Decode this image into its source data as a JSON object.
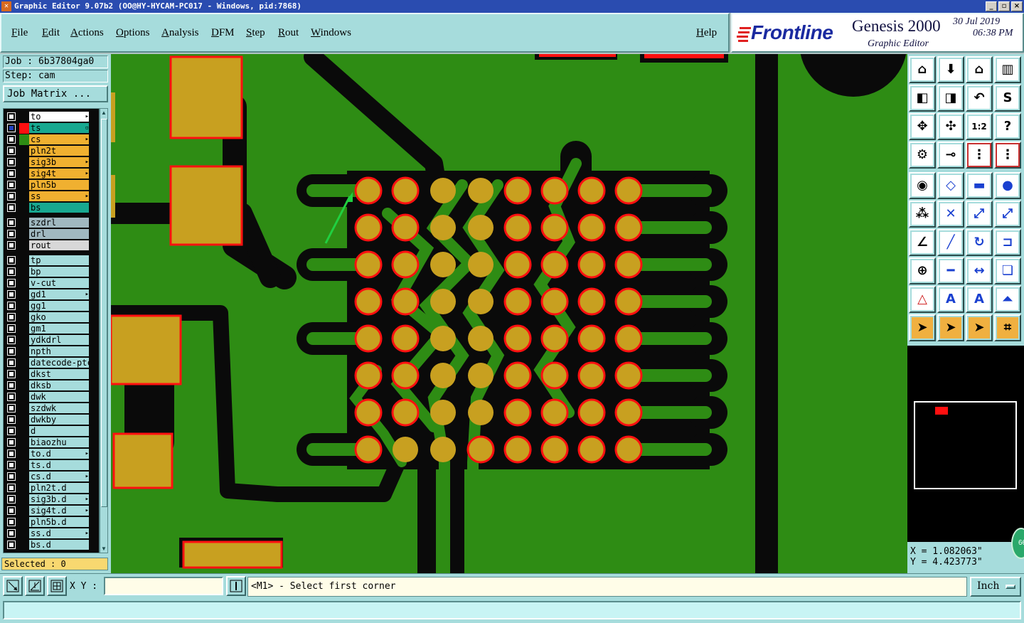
{
  "window": {
    "title": "Graphic Editor 9.07b2 (OO@HY-HYCAM-PC017 - Windows, pid:7868)",
    "app_icon": "x-app-icon",
    "controls": [
      "_",
      "▫",
      "×"
    ]
  },
  "menu": {
    "items": [
      "File",
      "Edit",
      "Actions",
      "Options",
      "Analysis",
      "DFM",
      "Step",
      "Rout",
      "Windows"
    ],
    "help": "Help"
  },
  "brand": {
    "logo": "Frontline",
    "product": "Genesis 2000",
    "subtitle": "Graphic Editor",
    "date": "30 Jul 2019",
    "time": "06:38 PM"
  },
  "job": {
    "job_label": "Job : 6b37804ga0",
    "step_label": "Step: cam",
    "matrix_button": "Job Matrix ..."
  },
  "layers": [
    {
      "name": "to",
      "bg": "#ffffff",
      "swatch": "#0a0a0a",
      "mark": "▸"
    },
    {
      "name": "ts",
      "bg": "#18a890",
      "swatch": "#ff1010",
      "mark": "▫",
      "selected": true
    },
    {
      "name": "cs",
      "bg": "#f0b030",
      "swatch": "#2e8c14",
      "mark": "▸"
    },
    {
      "name": "pln2t",
      "bg": "#f0b030",
      "swatch": "#0a0a0a",
      "mark": ""
    },
    {
      "name": "sig3b",
      "bg": "#f0b030",
      "swatch": "#0a0a0a",
      "mark": "▸"
    },
    {
      "name": "sig4t",
      "bg": "#f0b030",
      "swatch": "#0a0a0a",
      "mark": "▸"
    },
    {
      "name": "pln5b",
      "bg": "#f0b030",
      "swatch": "#0a0a0a",
      "mark": ""
    },
    {
      "name": "ss",
      "bg": "#f0b030",
      "swatch": "#0a0a0a",
      "mark": "▸"
    },
    {
      "name": "bs",
      "bg": "#18a890",
      "swatch": "#0a0a0a",
      "mark": ""
    },
    {
      "name": "szdrl",
      "bg": "#a0b8c0",
      "swatch": "#0a0a0a",
      "mark": "",
      "gap": true
    },
    {
      "name": "drl",
      "bg": "#a0b8c0",
      "swatch": "#0a0a0a",
      "mark": ""
    },
    {
      "name": "rout",
      "bg": "#d8d8d8",
      "swatch": "#0a0a0a",
      "mark": ""
    },
    {
      "name": "tp",
      "bg": "#a6dcdc",
      "swatch": "#0a0a0a",
      "mark": "",
      "gap": true
    },
    {
      "name": "bp",
      "bg": "#a6dcdc",
      "swatch": "#0a0a0a",
      "mark": ""
    },
    {
      "name": "v-cut",
      "bg": "#a6dcdc",
      "swatch": "#0a0a0a",
      "mark": ""
    },
    {
      "name": "gd1",
      "bg": "#a6dcdc",
      "swatch": "#0a0a0a",
      "mark": "▸"
    },
    {
      "name": "gg1",
      "bg": "#a6dcdc",
      "swatch": "#0a0a0a",
      "mark": ""
    },
    {
      "name": "gko",
      "bg": "#a6dcdc",
      "swatch": "#0a0a0a",
      "mark": ""
    },
    {
      "name": "gm1",
      "bg": "#a6dcdc",
      "swatch": "#0a0a0a",
      "mark": ""
    },
    {
      "name": "ydkdrl",
      "bg": "#a6dcdc",
      "swatch": "#0a0a0a",
      "mark": ""
    },
    {
      "name": "npth",
      "bg": "#a6dcdc",
      "swatch": "#0a0a0a",
      "mark": ""
    },
    {
      "name": "datecode-ptc",
      "bg": "#a6dcdc",
      "swatch": "#0a0a0a",
      "mark": ""
    },
    {
      "name": "dkst",
      "bg": "#a6dcdc",
      "swatch": "#0a0a0a",
      "mark": ""
    },
    {
      "name": "dksb",
      "bg": "#a6dcdc",
      "swatch": "#0a0a0a",
      "mark": ""
    },
    {
      "name": "dwk",
      "bg": "#a6dcdc",
      "swatch": "#0a0a0a",
      "mark": ""
    },
    {
      "name": "szdwk",
      "bg": "#a6dcdc",
      "swatch": "#0a0a0a",
      "mark": ""
    },
    {
      "name": "dwkby",
      "bg": "#a6dcdc",
      "swatch": "#0a0a0a",
      "mark": ""
    },
    {
      "name": "d",
      "bg": "#a6dcdc",
      "swatch": "#0a0a0a",
      "mark": ""
    },
    {
      "name": "biaozhu",
      "bg": "#a6dcdc",
      "swatch": "#0a0a0a",
      "mark": ""
    },
    {
      "name": "to.d",
      "bg": "#a6dcdc",
      "swatch": "#0a0a0a",
      "mark": "▸"
    },
    {
      "name": "ts.d",
      "bg": "#a6dcdc",
      "swatch": "#0a0a0a",
      "mark": ""
    },
    {
      "name": "cs.d",
      "bg": "#a6dcdc",
      "swatch": "#0a0a0a",
      "mark": "▸"
    },
    {
      "name": "pln2t.d",
      "bg": "#a6dcdc",
      "swatch": "#0a0a0a",
      "mark": ""
    },
    {
      "name": "sig3b.d",
      "bg": "#a6dcdc",
      "swatch": "#0a0a0a",
      "mark": "▸"
    },
    {
      "name": "sig4t.d",
      "bg": "#a6dcdc",
      "swatch": "#0a0a0a",
      "mark": "▸"
    },
    {
      "name": "pln5b.d",
      "bg": "#a6dcdc",
      "swatch": "#0a0a0a",
      "mark": ""
    },
    {
      "name": "ss.d",
      "bg": "#a6dcdc",
      "swatch": "#0a0a0a",
      "mark": "▸"
    },
    {
      "name": "bs.d",
      "bg": "#a6dcdc",
      "swatch": "#0a0a0a",
      "mark": ""
    }
  ],
  "selection": {
    "label": "Selected : 0"
  },
  "coords": {
    "x": "X = 1.082063\"",
    "y": "Y = 4.423773\""
  },
  "badge": "66",
  "command": {
    "xy_label": "X Y :",
    "xy_value": "",
    "prompt": "<M1> - Select first corner",
    "unit": "Inch"
  },
  "status": {
    "text": ""
  },
  "tools": [
    "home-icon",
    "move-down-icon",
    "house-icon",
    "panel-icon",
    "left-arrow-box-icon",
    "right-arrow-box-icon",
    "undo-zoom-icon",
    "s-curve-icon",
    "zoom-fit-icon",
    "pan-icon",
    "scale-1to2-icon",
    "help-icon",
    "settings-icon",
    "measure-icon",
    "snap-icon",
    "snap-red-icon",
    "pad-icon",
    "shape-icon",
    "ruler-icon",
    "circle-pad-icon",
    "nodes-icon",
    "cross-icon",
    "connect-icon",
    "connect2-icon",
    "angle-icon",
    "line-icon",
    "arc-icon",
    "split-icon",
    "add-pad-icon",
    "minus-icon",
    "dimension-icon",
    "copy-icon",
    "triangle-a-icon",
    "triangle-b-icon",
    "triangle-c-icon",
    "triangle-d-icon",
    "pointer-icon",
    "select-icon",
    "select-area-icon",
    "route-icon"
  ],
  "colors": {
    "board": "#2e8c14",
    "copper": "#c8a020",
    "mask": "#ff1010",
    "clearance": "#0a0a0a",
    "panel": "#a6dcdc"
  }
}
